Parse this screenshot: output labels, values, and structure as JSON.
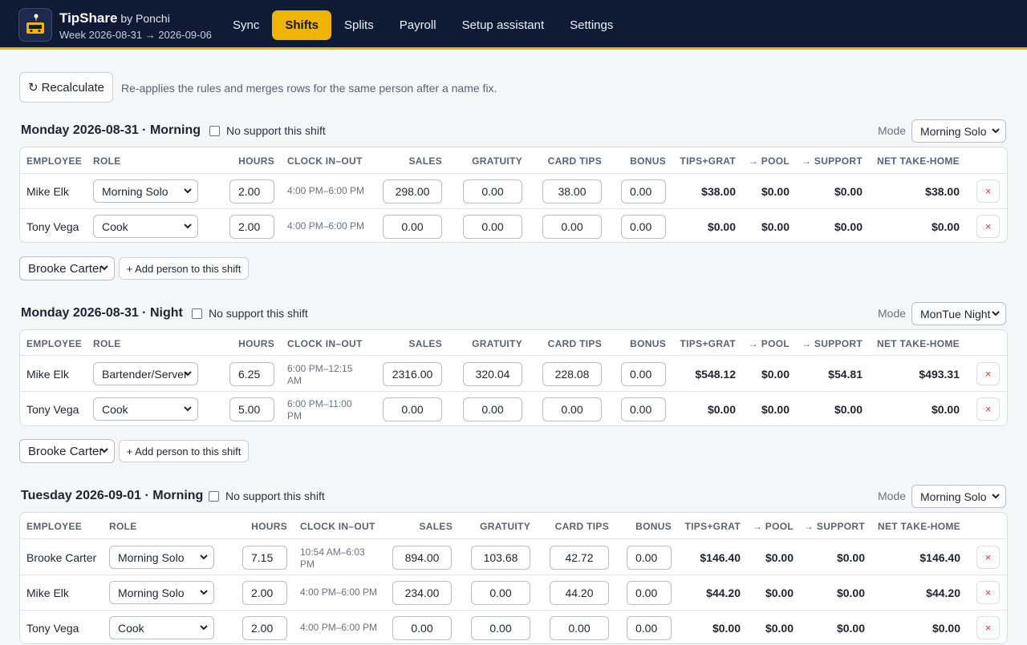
{
  "app": {
    "name": "TipShare",
    "by": "by Ponchi",
    "week": "Week 2026-08-31 → 2026-09-06",
    "accent": "#f0b400",
    "header_bg": "#0f1a35"
  },
  "nav": [
    "Sync",
    "Shifts",
    "Splits",
    "Payroll",
    "Setup assistant",
    "Settings"
  ],
  "nav_active": "Shifts",
  "toolbar": {
    "recalc_label": "Recalculate",
    "recalc_icon": "↻",
    "recalc_note": "Re-applies the rules and merges rows for the same person after a name fix."
  },
  "common": {
    "no_support": "No support this shift",
    "mode_label": "Mode",
    "add_person": "+ Add person to this shift",
    "remove_glyph": "×"
  },
  "headers": [
    "EMPLOYEE",
    "ROLE",
    "HOURS",
    "CLOCK IN–OUT",
    "SALES",
    "GRATUITY",
    "CARD TIPS",
    "BONUS",
    "TIPS+GRAT",
    "→ POOL",
    "→ SUPPORT",
    "NET TAKE-HOME"
  ],
  "shifts": [
    {
      "title": "Monday 2026-08-31 · Morning",
      "mode": "Morning Solo",
      "add_person_select": "Brooke Carter",
      "rows": [
        {
          "employee": "Mike Elk",
          "role": "Morning Solo",
          "hours": "2.00",
          "clock": "4:00 PM–6:00 PM",
          "sales": "298.00",
          "gratuity": "0.00",
          "card_tips": "38.00",
          "bonus": "0.00",
          "tips_grat": "$38.00",
          "pool": "$0.00",
          "support": "$0.00",
          "net": "$38.00"
        },
        {
          "employee": "Tony Vega",
          "role": "Cook",
          "hours": "2.00",
          "clock": "4:00 PM–6:00 PM",
          "sales": "0.00",
          "gratuity": "0.00",
          "card_tips": "0.00",
          "bonus": "0.00",
          "tips_grat": "$0.00",
          "pool": "$0.00",
          "support": "$0.00",
          "net": "$0.00"
        }
      ]
    },
    {
      "title": "Monday 2026-08-31 · Night",
      "mode": "MonTue Night",
      "add_person_select": "Brooke Carter",
      "rows": [
        {
          "employee": "Mike Elk",
          "role": "Bartender/Server",
          "hours": "6.25",
          "clock": "6:00 PM–12:15 AM",
          "sales": "2316.00",
          "gratuity": "320.04",
          "card_tips": "228.08",
          "bonus": "0.00",
          "tips_grat": "$548.12",
          "pool": "$0.00",
          "support": "$54.81",
          "net": "$493.31"
        },
        {
          "employee": "Tony Vega",
          "role": "Cook",
          "hours": "5.00",
          "clock": "6:00 PM–11:00 PM",
          "sales": "0.00",
          "gratuity": "0.00",
          "card_tips": "0.00",
          "bonus": "0.00",
          "tips_grat": "$0.00",
          "pool": "$0.00",
          "support": "$0.00",
          "net": "$0.00"
        }
      ]
    },
    {
      "title": "Tuesday 2026-09-01 · Morning",
      "mode": "Morning Solo",
      "rows": [
        {
          "employee": "Brooke Carter",
          "role": "Morning Solo",
          "hours": "7.15",
          "clock": "10:54 AM–6:03 PM",
          "sales": "894.00",
          "gratuity": "103.68",
          "card_tips": "42.72",
          "bonus": "0.00",
          "tips_grat": "$146.40",
          "pool": "$0.00",
          "support": "$0.00",
          "net": "$146.40"
        },
        {
          "employee": "Mike Elk",
          "role": "Morning Solo",
          "hours": "2.00",
          "clock": "4:00 PM–6:00 PM",
          "sales": "234.00",
          "gratuity": "0.00",
          "card_tips": "44.20",
          "bonus": "0.00",
          "tips_grat": "$44.20",
          "pool": "$0.00",
          "support": "$0.00",
          "net": "$44.20"
        },
        {
          "employee": "Tony Vega",
          "role": "Cook",
          "hours": "2.00",
          "clock": "4:00 PM–6:00 PM",
          "sales": "0.00",
          "gratuity": "0.00",
          "card_tips": "0.00",
          "bonus": "0.00",
          "tips_grat": "$0.00",
          "pool": "$0.00",
          "support": "$0.00",
          "net": "$0.00"
        }
      ]
    }
  ]
}
